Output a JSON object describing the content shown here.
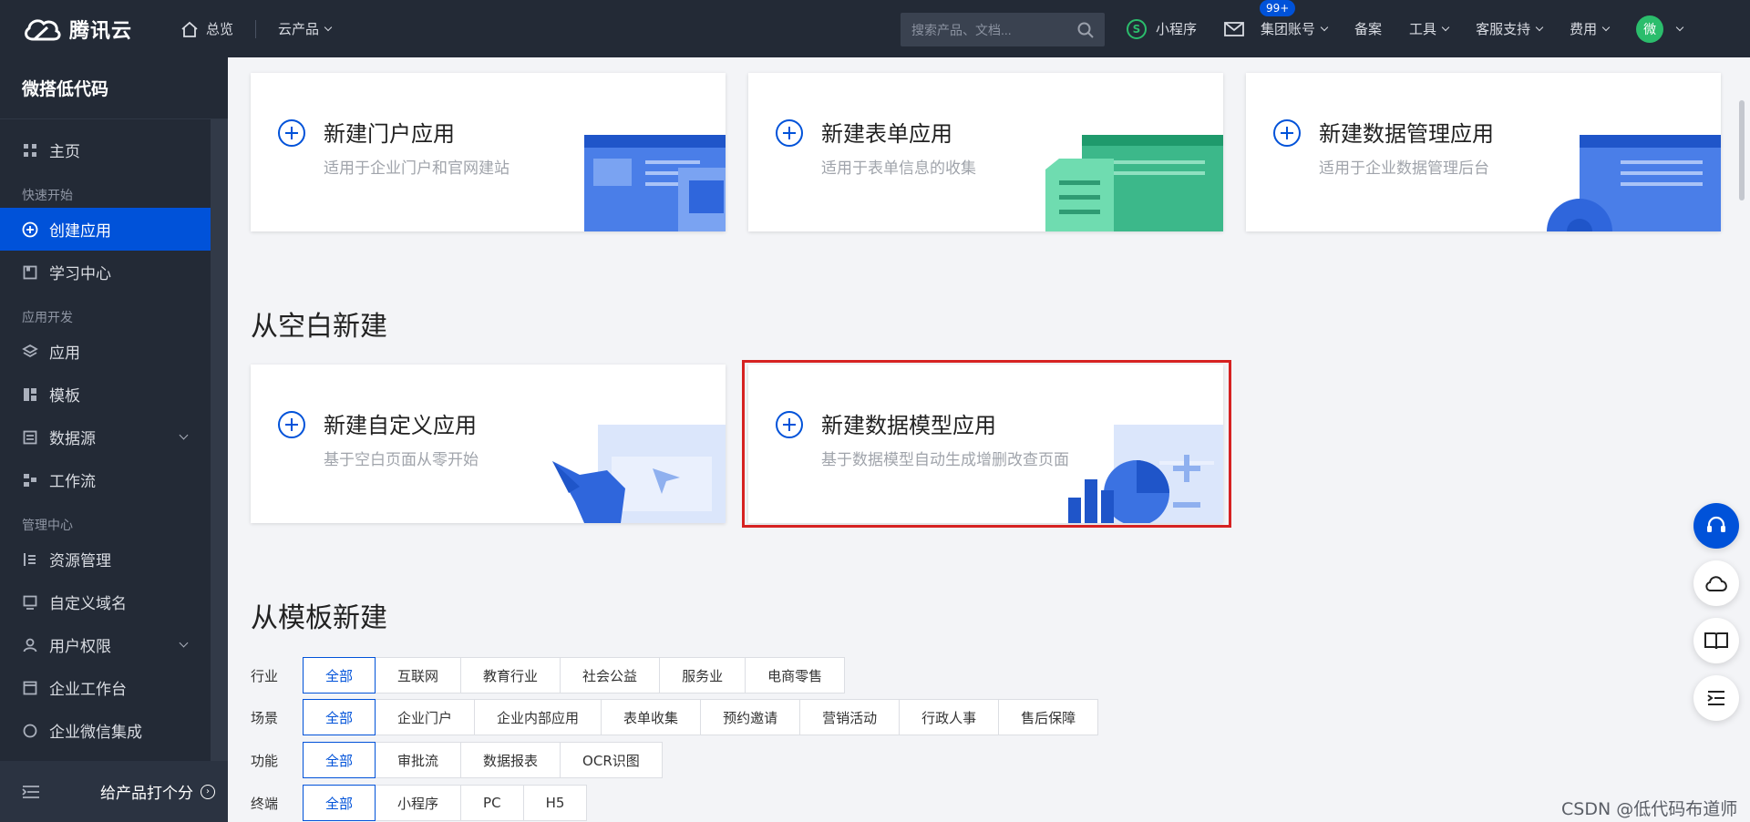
{
  "topbar": {
    "brand": "腾讯云",
    "home_label": "总览",
    "products_label": "云产品",
    "search_placeholder": "搜索产品、文档...",
    "mini_program": "小程序",
    "mail_badge": "99+",
    "group_account": "集团账号",
    "filing": "备案",
    "tools": "工具",
    "support": "客服支持",
    "billing": "费用",
    "avatar_char": "微"
  },
  "sidebar": {
    "title": "微搭低代码",
    "home": "主页",
    "group_quick": "快速开始",
    "create_app": "创建应用",
    "learning": "学习中心",
    "group_dev": "应用开发",
    "apps": "应用",
    "templates": "模板",
    "datasource": "数据源",
    "workflow": "工作流",
    "group_admin": "管理中心",
    "resources": "资源管理",
    "custom_domain": "自定义域名",
    "user_perm": "用户权限",
    "enterprise_desk": "企业工作台",
    "wecom": "企业微信集成",
    "rate": "给产品打个分"
  },
  "cards_top": [
    {
      "title": "新建门户应用",
      "desc": "适用于企业门户和官网建站"
    },
    {
      "title": "新建表单应用",
      "desc": "适用于表单信息的收集"
    },
    {
      "title": "新建数据管理应用",
      "desc": "适用于企业数据管理后台"
    }
  ],
  "blank_section": {
    "title": "从空白新建",
    "cards": [
      {
        "title": "新建自定义应用",
        "desc": "基于空白页面从零开始"
      },
      {
        "title": "新建数据模型应用",
        "desc": "基于数据模型自动生成增删改查页面"
      }
    ]
  },
  "template_section": {
    "title": "从模板新建",
    "filters": [
      {
        "label": "行业",
        "options": [
          "全部",
          "互联网",
          "教育行业",
          "社会公益",
          "服务业",
          "电商零售"
        ]
      },
      {
        "label": "场景",
        "options": [
          "全部",
          "企业门户",
          "企业内部应用",
          "表单收集",
          "预约邀请",
          "营销活动",
          "行政人事",
          "售后保障"
        ]
      },
      {
        "label": "功能",
        "options": [
          "全部",
          "审批流",
          "数据报表",
          "OCR识图"
        ]
      },
      {
        "label": "终端",
        "options": [
          "全部",
          "小程序",
          "PC",
          "H5"
        ]
      }
    ]
  },
  "watermark": "CSDN @低代码布道师",
  "colors": {
    "accent": "#0052d9",
    "highlight": "#d62222",
    "nav_bg": "#232a36"
  }
}
